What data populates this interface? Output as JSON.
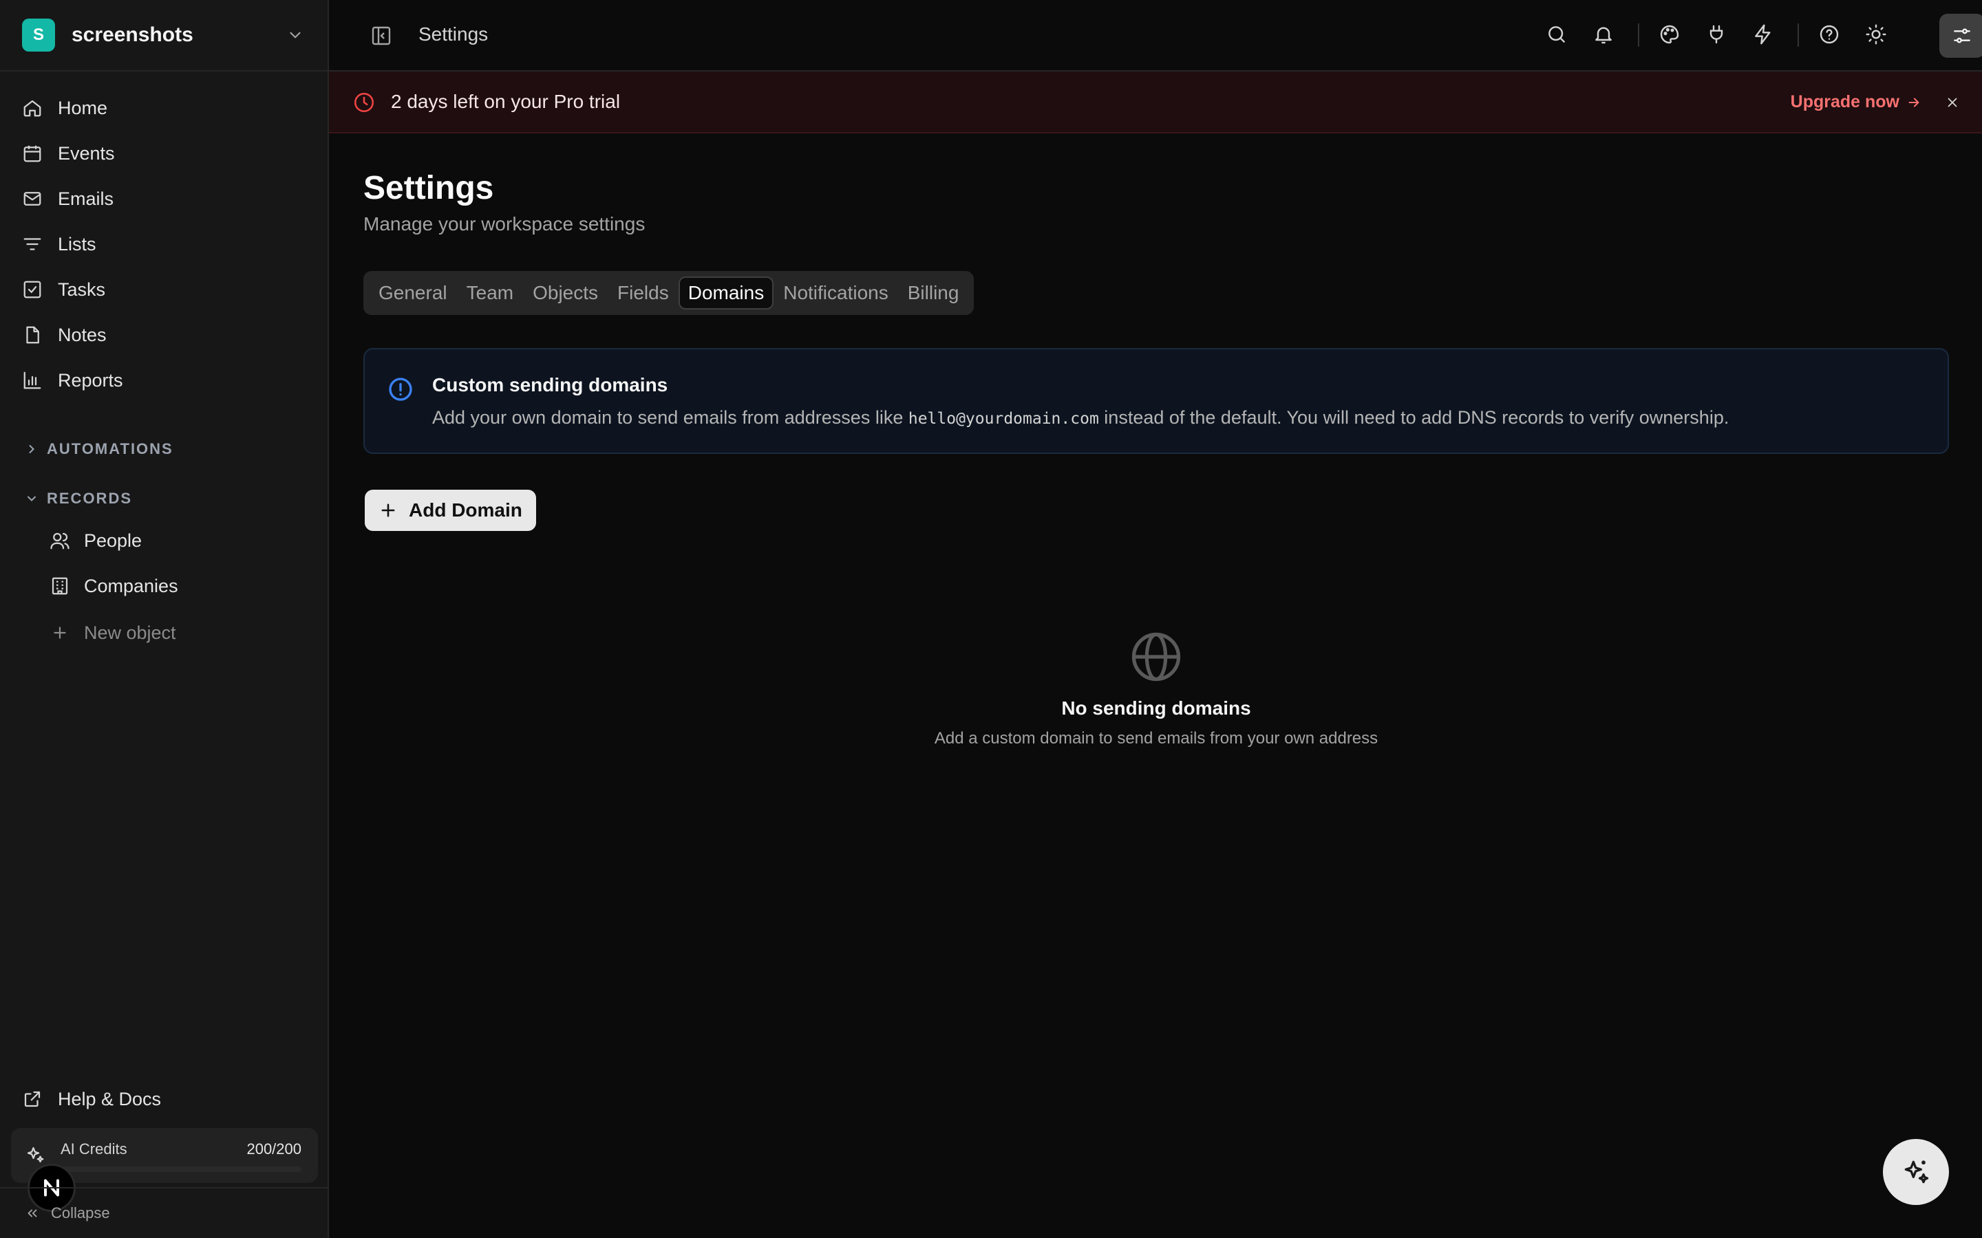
{
  "workspace": {
    "initial": "S",
    "name": "screenshots"
  },
  "nav": {
    "items": [
      {
        "label": "Home"
      },
      {
        "label": "Events"
      },
      {
        "label": "Emails"
      },
      {
        "label": "Lists"
      },
      {
        "label": "Tasks"
      },
      {
        "label": "Notes"
      },
      {
        "label": "Reports"
      }
    ],
    "automations_label": "AUTOMATIONS",
    "records_label": "RECORDS",
    "records": [
      {
        "label": "People"
      },
      {
        "label": "Companies"
      }
    ],
    "new_object_label": "New object",
    "help_label": "Help & Docs",
    "credits": {
      "label": "AI Credits",
      "value": "200/200",
      "used_fraction": 1.0
    },
    "avatar_initial": "N",
    "collapse_label": "Collapse"
  },
  "topbar": {
    "title": "Settings"
  },
  "banner": {
    "text": "2 days left on your Pro trial",
    "upgrade_label": "Upgrade now"
  },
  "page": {
    "title": "Settings",
    "subtitle": "Manage your workspace settings",
    "tabs": [
      {
        "label": "General"
      },
      {
        "label": "Team"
      },
      {
        "label": "Objects"
      },
      {
        "label": "Fields"
      },
      {
        "label": "Domains"
      },
      {
        "label": "Notifications"
      },
      {
        "label": "Billing"
      }
    ],
    "active_tab": "Domains"
  },
  "info": {
    "title": "Custom sending domains",
    "body_before": "Add your own domain to send emails from addresses like ",
    "body_code": "hello@yourdomain.com",
    "body_after": " instead of the default. You will need to add DNS records to verify ownership."
  },
  "add_button_label": "Add Domain",
  "empty": {
    "title": "No sending domains",
    "subtitle": "Add a custom domain to send emails from your own address"
  },
  "colors": {
    "accent_teal": "#14b8a6",
    "banner_red": "#f87171",
    "info_blue": "#3b82f6"
  }
}
